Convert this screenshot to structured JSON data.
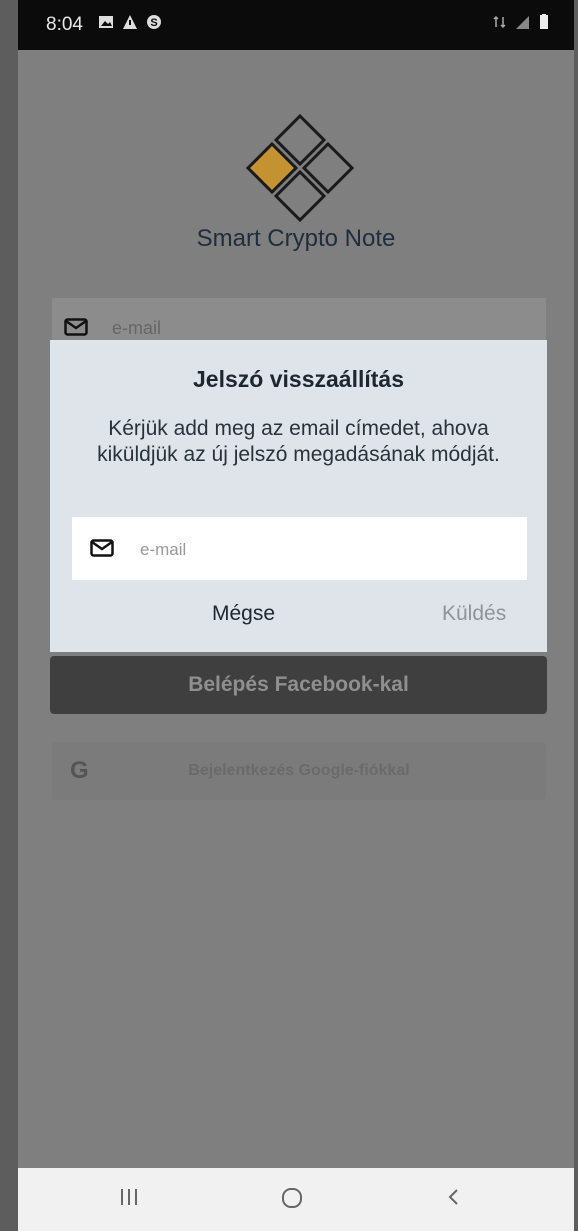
{
  "status_bar": {
    "time": "8:04",
    "left_icons": [
      "image-icon",
      "alert-icon",
      "s-icon"
    ],
    "right_icons": [
      "data-icon",
      "signal-icon",
      "battery-icon"
    ]
  },
  "app": {
    "title": "Smart Crypto Note",
    "logo_accent_color": "#c49331"
  },
  "login": {
    "email_placeholder": "e-mail",
    "facebook_label": "Belépés Facebook-kal",
    "google_label": "Bejelentkezés Google-fiókkal",
    "google_glyph": "G"
  },
  "dialog": {
    "title": "Jelszó visszaállítás",
    "message": "Kérjük add meg az email címedet, ahova kiküldjük az új jelszó megadásának módját.",
    "email_placeholder": "e-mail",
    "email_value": "",
    "cancel_label": "Mégse",
    "send_label": "Küldés"
  },
  "nav_bar": {
    "icons": [
      "recent-apps-icon",
      "home-icon",
      "back-icon"
    ]
  }
}
